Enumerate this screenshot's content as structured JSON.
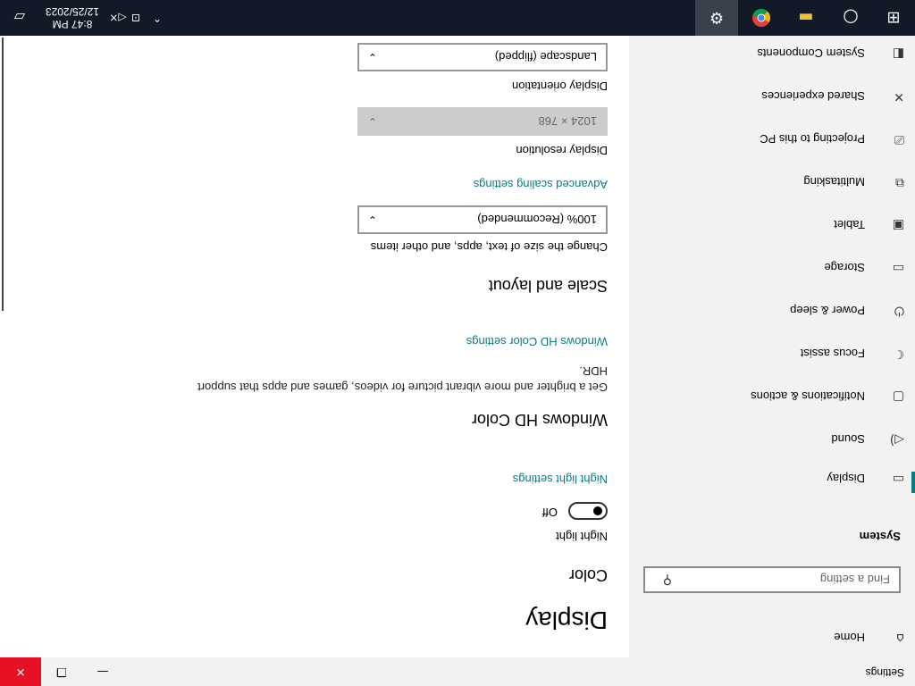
{
  "window": {
    "title": "Settings",
    "minimize": "—",
    "maximize": "❐",
    "close": "✕",
    "close_color": "#e81123"
  },
  "nav": {
    "home_label": "Home",
    "home_icon": "⌂",
    "search_placeholder": "Find a setting",
    "search_icon": "⚲",
    "heading": "System",
    "active_color": "#0f7b7b",
    "items": [
      {
        "label": "Display",
        "icon": "▭",
        "active": true
      },
      {
        "label": "Sound",
        "icon": "◁)"
      },
      {
        "label": "Notifications & actions",
        "icon": "▢"
      },
      {
        "label": "Focus assist",
        "icon": "☾"
      },
      {
        "label": "Power & sleep",
        "icon": "⏻"
      },
      {
        "label": "Storage",
        "icon": "▭"
      },
      {
        "label": "Tablet",
        "icon": "▣"
      },
      {
        "label": "Multitasking",
        "icon": "⧉"
      },
      {
        "label": "Projecting to this PC",
        "icon": "⎚"
      },
      {
        "label": "Shared experiences",
        "icon": "✕"
      },
      {
        "label": "System Components",
        "icon": "◧"
      }
    ]
  },
  "main": {
    "title": "Display",
    "color_heading": "Color",
    "night_light_label": "Night light",
    "night_light_state": "Off",
    "night_light_link": "Night light settings",
    "hd_heading": "Windows HD Color",
    "hd_desc": "Get a brighter and more vibrant picture for videos, games and apps that support HDR.",
    "hd_link": "Windows HD Color settings",
    "scale_heading": "Scale and layout",
    "scale_label": "Change the size of text, apps, and other items",
    "scale_value": "100% (Recommended)",
    "advanced_link": "Advanced scaling settings",
    "resolution_label": "Display resolution",
    "resolution_value": "1024 × 768",
    "orientation_label": "Display orientation",
    "orientation_value": "Landscape (flipped)",
    "chevron": "⌄"
  },
  "taskbar": {
    "start_icon": "⊞",
    "search_icon": "○",
    "explorer_icon": "▬",
    "chrome_icon": "◉",
    "settings_icon": "⚙",
    "tray_chevron": "⌃",
    "network_icon": "⊡",
    "volume_icon": "◁×",
    "time": "8:47 PM",
    "date": "12/25/2023",
    "notification_icon": "▱"
  }
}
